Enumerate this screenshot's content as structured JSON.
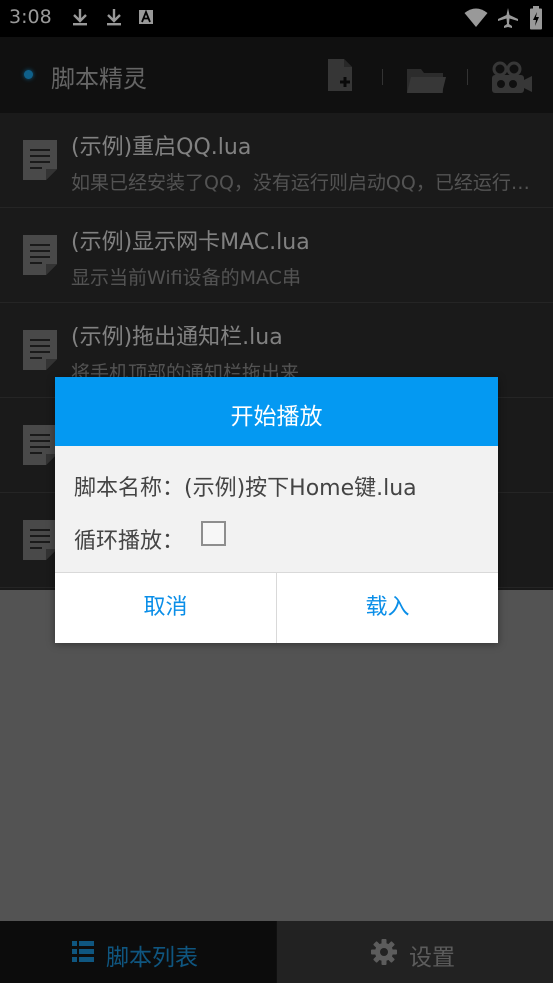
{
  "status_bar": {
    "time": "3:08"
  },
  "app_bar": {
    "title": "脚本精灵",
    "accent_color": "#1aa0e6"
  },
  "scripts": [
    {
      "name": "(示例)重启QQ.lua",
      "description": "如果已经安装了QQ，没有运行则启动QQ，已经运行则重启QQ"
    },
    {
      "name": "(示例)显示网卡MAC.lua",
      "description": "显示当前Wifi设备的MAC串"
    },
    {
      "name": "(示例)拖出通知栏.lua",
      "description": "将手机顶部的通知栏拖出来"
    },
    {
      "name": "",
      "description": ""
    },
    {
      "name": "",
      "description": ""
    }
  ],
  "dialog": {
    "title": "开始播放",
    "script_name_label": "脚本名称：(示例)按下Home键.lua",
    "loop_label": "循环播放：",
    "loop_checked": false,
    "cancel_label": "取消",
    "load_label": "载入",
    "header_color": "#0499f2"
  },
  "bottom_nav": {
    "tabs": [
      {
        "label": "脚本列表",
        "icon": "list-icon",
        "active": true
      },
      {
        "label": "设置",
        "icon": "gear-icon",
        "active": false
      }
    ]
  }
}
